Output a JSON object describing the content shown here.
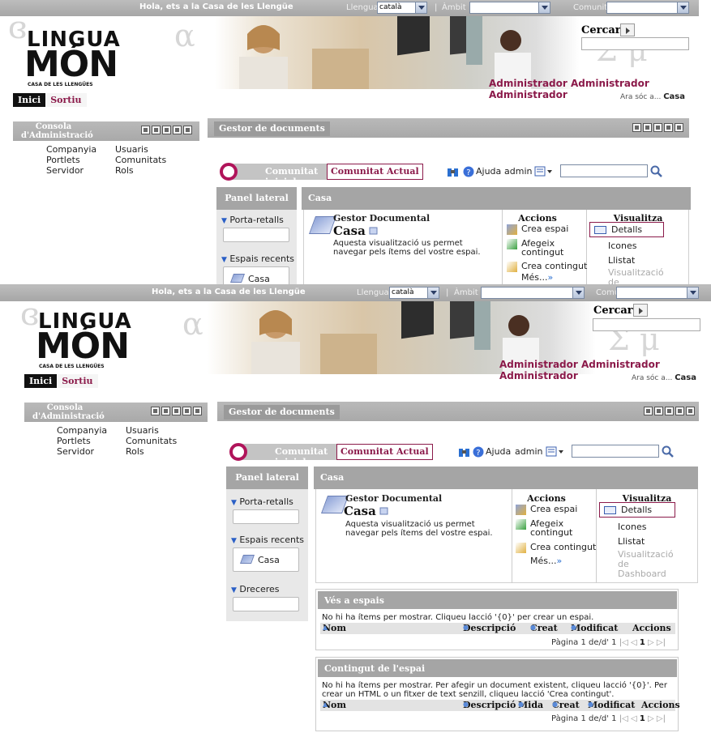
{
  "top": {
    "greeting": "Hola, ets a la Casa de les Llengüe",
    "language_label": "Llengua",
    "language_value": "català",
    "sep": "|",
    "scope_label": "Àmbit",
    "scope_value": "",
    "community_label": "Comunitat",
    "community_value": ""
  },
  "logo": {
    "line1": "LINGUA",
    "line2": "MÓN",
    "line3": "CASA DE LES LLENGÜES"
  },
  "search": {
    "label": "Cercar",
    "value": ""
  },
  "user": {
    "name": "Administrador Administrador Administrador",
    "here_prefix": "Ara sóc a...",
    "here_place": "Casa"
  },
  "nav": {
    "home": "Inici",
    "logout": "Sortiu"
  },
  "admin_console": {
    "title": "Consola d'Administració",
    "links": [
      "Companyia",
      "Usuaris",
      "Portlets",
      "Comunitats",
      "Servidor",
      "Rols"
    ]
  },
  "doc_manager": {
    "title": "Gestor de documents",
    "community_start": "Comunitat inicial",
    "community_current": "Comunitat Actual",
    "help": "Ajuda",
    "user": "admin",
    "search_value": ""
  },
  "side_panel": {
    "title": "Panel lateral",
    "clipboard": "Porta-retalls",
    "recent": "Espais recents",
    "recent_item": "Casa",
    "shortcuts": "Dreceres"
  },
  "main": {
    "header": "Casa",
    "dm_title": "Gestor Documental",
    "space_name": "Casa",
    "description": "Aquesta visualització us permet navegar pels ítems del vostre espai.",
    "actions_title": "Accions",
    "actions": [
      "Crea espai",
      "Afegeix contingut",
      "Crea contingut",
      "Més..."
    ],
    "view_title": "Visualitza",
    "views": [
      "Detalls",
      "Icones",
      "Llistat",
      "Visualització de Dashboard"
    ]
  },
  "spaces_section": {
    "title": "Vés a espais",
    "message": "No hi ha ítems per mostrar. Cliqueu lacció '{0}' per crear un espai.",
    "cols": [
      "Nom",
      "Descripció",
      "Creat",
      "Modificat",
      "Accions"
    ],
    "pager": "Pàgina 1 de/d' 1",
    "page": "1"
  },
  "content_section": {
    "title": "Contingut de l'espai",
    "message": "No hi ha ítems per mostrar. Per afegir un document existent, cliqueu lacció '{0}'. Per crear un HTML o un fitxer de text senzill, cliqueu lacció 'Crea contingut'.",
    "cols": [
      "Nom",
      "Descripció",
      "Mida",
      "Creat",
      "Modificat",
      "Accions"
    ],
    "pager": "Pàgina 1 de/d' 1",
    "page": "1"
  }
}
